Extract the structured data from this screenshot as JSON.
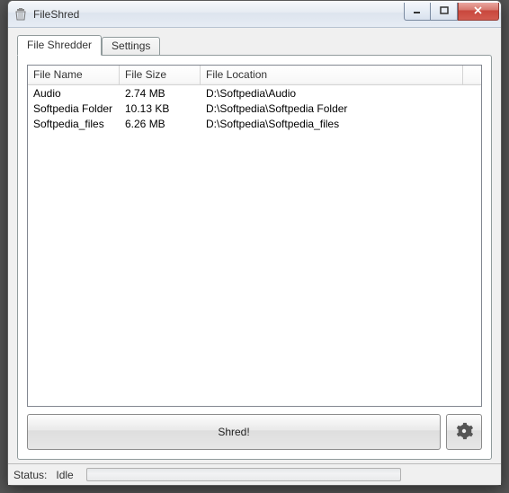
{
  "window": {
    "title": "FileShred"
  },
  "tabs": [
    {
      "label": "File Shredder",
      "active": true
    },
    {
      "label": "Settings",
      "active": false
    }
  ],
  "listview": {
    "columns": [
      "File Name",
      "File Size",
      "File Location"
    ],
    "rows": [
      {
        "name": "Audio",
        "size": "2.74 MB",
        "location": "D:\\Softpedia\\Audio"
      },
      {
        "name": "Softpedia Folder",
        "size": "10.13 KB",
        "location": "D:\\Softpedia\\Softpedia Folder"
      },
      {
        "name": "Softpedia_files",
        "size": "6.26 MB",
        "location": "D:\\Softpedia\\Softpedia_files"
      }
    ]
  },
  "buttons": {
    "shred": "Shred!"
  },
  "status": {
    "label": "Status:",
    "value": "Idle",
    "progress": 0
  }
}
